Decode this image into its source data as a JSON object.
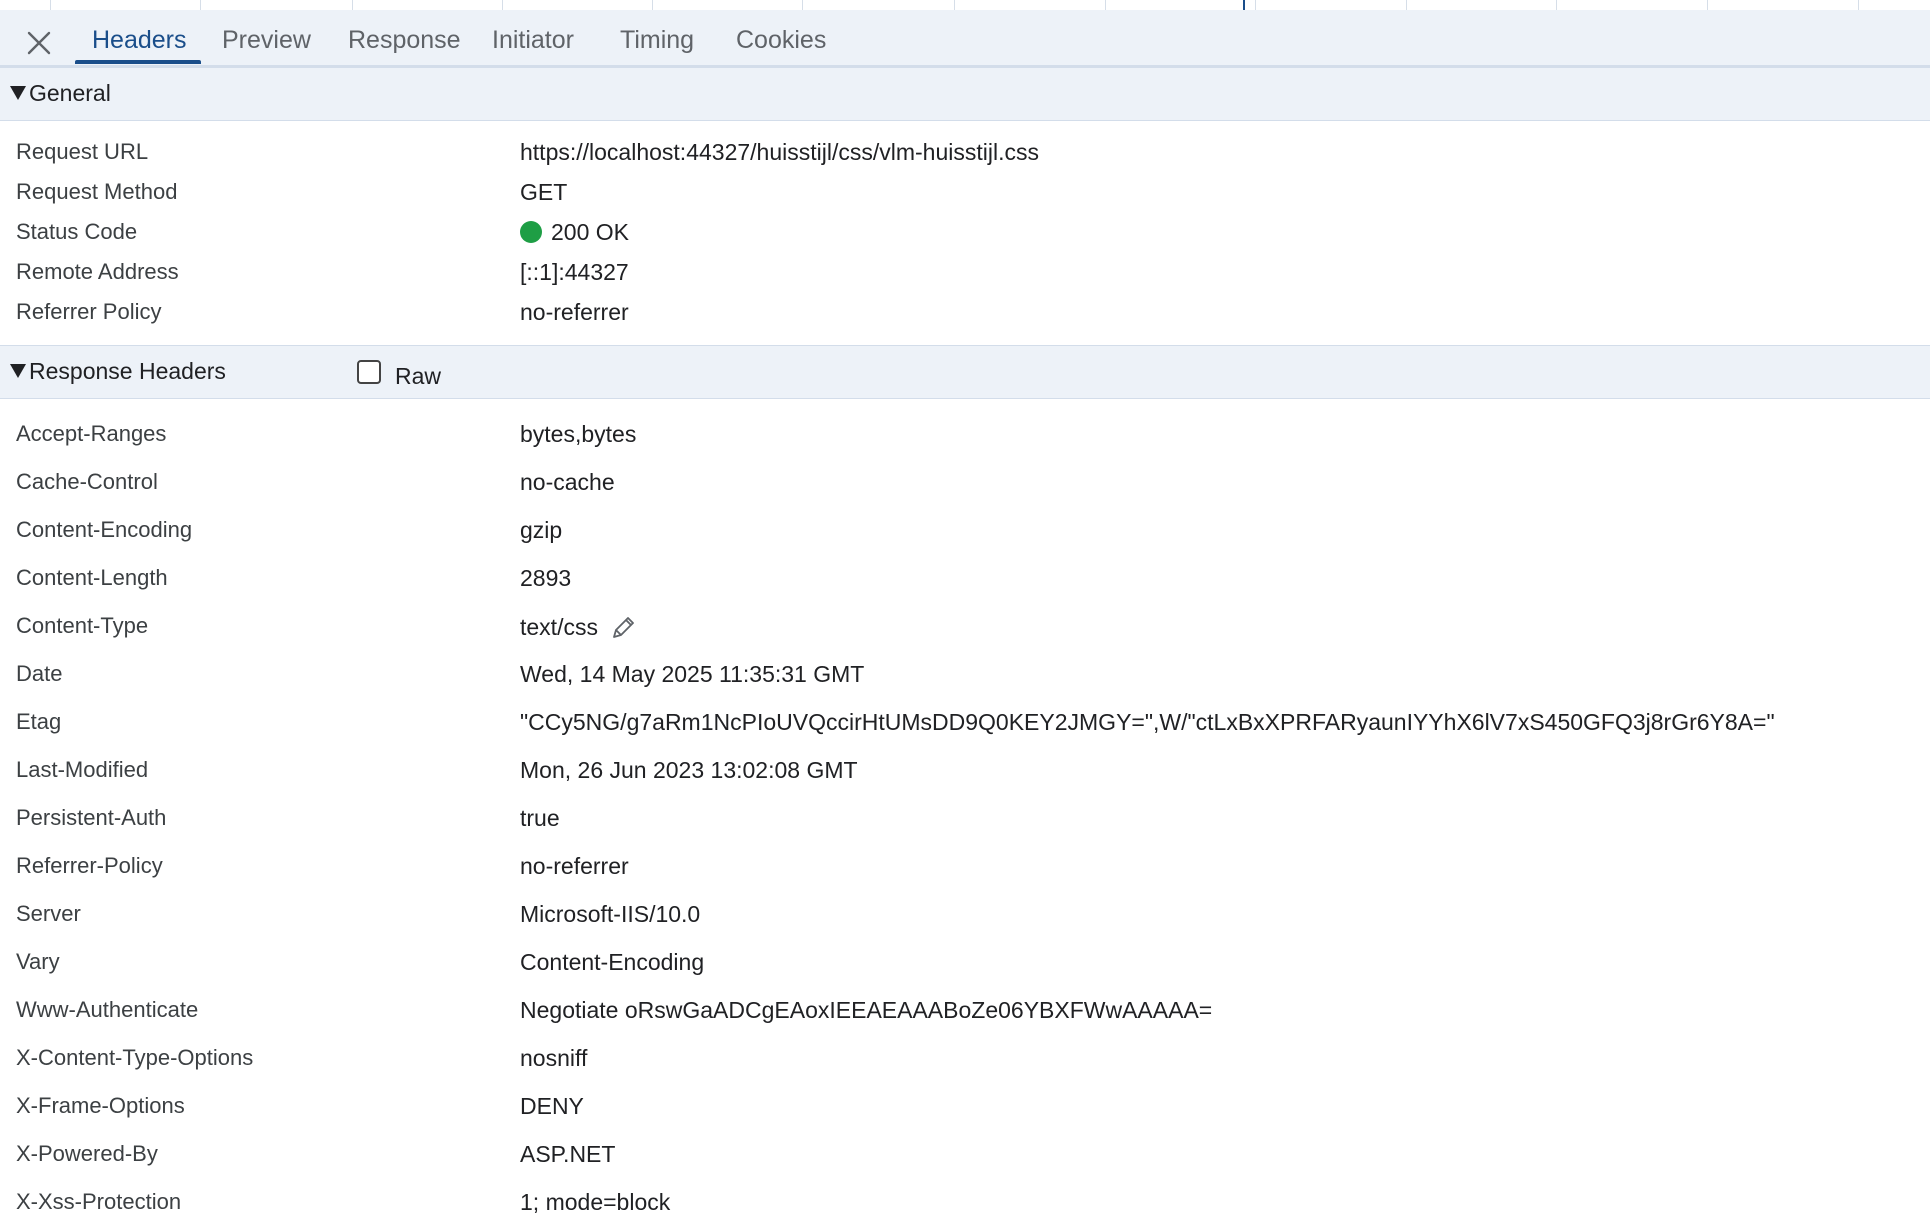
{
  "tabs": [
    {
      "label": "Headers",
      "active": true
    },
    {
      "label": "Preview"
    },
    {
      "label": "Response"
    },
    {
      "label": "Initiator"
    },
    {
      "label": "Timing"
    },
    {
      "label": "Cookies"
    }
  ],
  "general": {
    "title": "General",
    "rows": [
      {
        "key": "Request URL",
        "value": "https://localhost:44327/huisstijl/css/vlm-huisstijl.css"
      },
      {
        "key": "Request Method",
        "value": "GET"
      },
      {
        "key": "Status Code",
        "value": "200 OK"
      },
      {
        "key": "Remote Address",
        "value": "[::1]:44327"
      },
      {
        "key": "Referrer Policy",
        "value": "no-referrer"
      }
    ]
  },
  "response_headers": {
    "title": "Response Headers",
    "raw_label": "Raw",
    "rows": [
      {
        "key": "Accept-Ranges",
        "value": "bytes,bytes"
      },
      {
        "key": "Cache-Control",
        "value": "no-cache"
      },
      {
        "key": "Content-Encoding",
        "value": "gzip"
      },
      {
        "key": "Content-Length",
        "value": "2893"
      },
      {
        "key": "Content-Type",
        "value": "text/css"
      },
      {
        "key": "Date",
        "value": "Wed, 14 May 2025 11:35:31 GMT"
      },
      {
        "key": "Etag",
        "value": "\"CCy5NG/g7aRm1NcPIoUVQccirHtUMsDD9Q0KEY2JMGY=\",W/\"ctLxBxXPRFARyaunIYYhX6lV7xS450GFQ3j8rGr6Y8A=\""
      },
      {
        "key": "Last-Modified",
        "value": "Mon, 26 Jun 2023 13:02:08 GMT"
      },
      {
        "key": "Persistent-Auth",
        "value": "true"
      },
      {
        "key": "Referrer-Policy",
        "value": "no-referrer"
      },
      {
        "key": "Server",
        "value": "Microsoft-IIS/10.0"
      },
      {
        "key": "Vary",
        "value": "Content-Encoding"
      },
      {
        "key": "Www-Authenticate",
        "value": "Negotiate oRswGaADCgEAoxIEEAEAAABoZe06YBXFWwAAAAA="
      },
      {
        "key": "X-Content-Type-Options",
        "value": "nosniff"
      },
      {
        "key": "X-Frame-Options",
        "value": "DENY"
      },
      {
        "key": "X-Powered-By",
        "value": "ASP.NET"
      },
      {
        "key": "X-Xss-Protection",
        "value": "1; mode=block"
      }
    ]
  },
  "colors": {
    "accent": "#1a4e8a",
    "status_ok": "#1e9e45",
    "section_bg": "#edf2f8"
  },
  "icons": {
    "close": "close-icon",
    "expand": "triangle-down-icon",
    "edit": "pencil-icon",
    "status": "status-dot-icon"
  }
}
